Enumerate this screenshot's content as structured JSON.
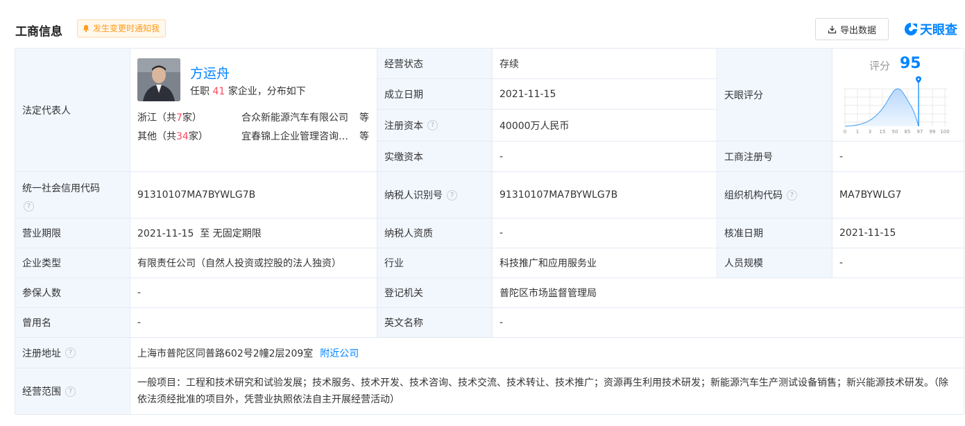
{
  "header": {
    "title": "工商信息",
    "notify_label": "发生变更时通知我",
    "export_label": "导出数据",
    "brand": "天眼查"
  },
  "rep": {
    "label": "法定代表人",
    "name": "方运舟",
    "line_pre": "任职 ",
    "count": "41",
    "line_post": " 家企业，分布如下",
    "rows": [
      {
        "region_pre": "浙江（共",
        "region_count": "7",
        "region_post": "家）",
        "company": "合众新能源汽车有限公司",
        "suffix": "等"
      },
      {
        "region_pre": "其他（共",
        "region_count": "34",
        "region_post": "家）",
        "company": "宜春锦上企业管理咨询有限公司",
        "suffix": "等"
      }
    ]
  },
  "fields": {
    "status_label": "经营状态",
    "status": "存续",
    "est_label": "成立日期",
    "est": "2021-11-15",
    "capital_label": "注册资本",
    "capital": "40000万人民币",
    "paid_label": "实缴资本",
    "paid": "-",
    "score_label": "天眼评分",
    "regno_label": "工商注册号",
    "regno": "-",
    "credit_label": "统一社会信用代码",
    "credit": "91310107MA7BYWLG7B",
    "taxid_label": "纳税人识别号",
    "taxid": "91310107MA7BYWLG7B",
    "org_label": "组织机构代码",
    "org": "MA7BYWLG7",
    "term_label": "营业期限",
    "term": "2021-11-15  至 无固定期限",
    "taxq_label": "纳税人资质",
    "taxq": "-",
    "approve_label": "核准日期",
    "approve": "2021-11-15",
    "type_label": "企业类型",
    "type": "有限责任公司（自然人投资或控股的法人独资）",
    "industry_label": "行业",
    "industry": "科技推广和应用服务业",
    "staff_label": "人员规模",
    "staff": "-",
    "insured_label": "参保人数",
    "insured": "-",
    "authority_label": "登记机关",
    "authority": "普陀区市场监督管理局",
    "former_label": "曾用名",
    "former": "-",
    "en_label": "英文名称",
    "en": "-",
    "address_label": "注册地址",
    "address": "上海市普陀区同普路602号2幢2层209室",
    "nearby": "附近公司",
    "scope_label": "经营范围",
    "scope": "一般项目：工程和技术研究和试验发展；技术服务、技术开发、技术咨询、技术交流、技术转让、技术推广；资源再生利用技术研发；新能源汽车生产测试设备销售；新兴能源技术研发。（除依法须经批准的项目外，凭营业执照依法自主开展经营活动）"
  },
  "score": {
    "label": "评分",
    "value": "95",
    "ticks": [
      "0",
      "1",
      "3",
      "15",
      "50",
      "85",
      "97",
      "99",
      "100"
    ]
  },
  "colors": {
    "accent": "#0084ff",
    "label_bg": "#f2f7fe",
    "highlight": "#fd485e"
  },
  "icons": {
    "notify": "bell-icon",
    "export": "download-icon",
    "help": "question-circle-icon",
    "brand": "tianyancha-logo"
  }
}
